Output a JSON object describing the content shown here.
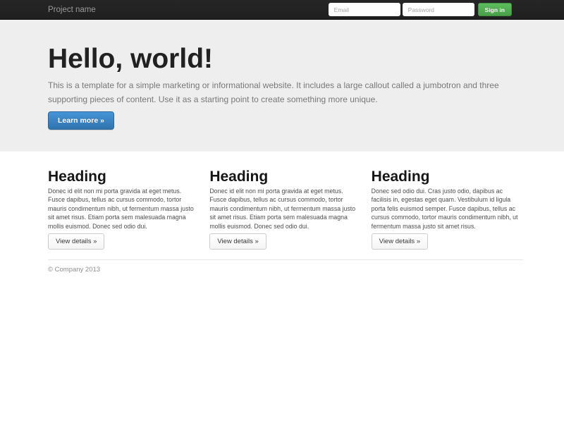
{
  "navbar": {
    "brand": "Project name",
    "email_placeholder": "Email",
    "password_placeholder": "Password",
    "signin_label": "Sign in",
    "bg_color": "#232323",
    "signin_color": "#51a351"
  },
  "jumbotron": {
    "title": "Hello, world!",
    "description": "This is a template for a simple marketing or informational website. It includes a large callout called a jumbotron and three supporting pieces of content. Use it as a starting point to create something more unique.",
    "cta_label": "Learn more »",
    "bg_color": "#eeeeee",
    "cta_color": "#3b83c6"
  },
  "columns": [
    {
      "heading": "Heading",
      "body": "Donec id elit non mi porta gravida at eget metus. Fusce dapibus, tellus ac cursus commodo, tortor mauris condimentum nibh, ut fermentum massa justo sit amet risus. Etiam porta sem malesuada magna mollis euismod. Donec sed odio dui.",
      "button_label": "View details »"
    },
    {
      "heading": "Heading",
      "body": "Donec id elit non mi porta gravida at eget metus. Fusce dapibus, tellus ac cursus commodo, tortor mauris condimentum nibh, ut fermentum massa justo sit amet risus. Etiam porta sem malesuada magna mollis euismod. Donec sed odio dui.",
      "button_label": "View details »"
    },
    {
      "heading": "Heading",
      "body": "Donec sed odio dui. Cras justo odio, dapibus ac facilisis in, egestas eget quam. Vestibulum id ligula porta felis euismod semper. Fusce dapibus, tellus ac cursus commodo, tortor mauris condimentum nibh, ut fermentum massa justo sit amet risus.",
      "button_label": "View details »"
    }
  ],
  "footer": {
    "copyright": "© Company 2013"
  }
}
